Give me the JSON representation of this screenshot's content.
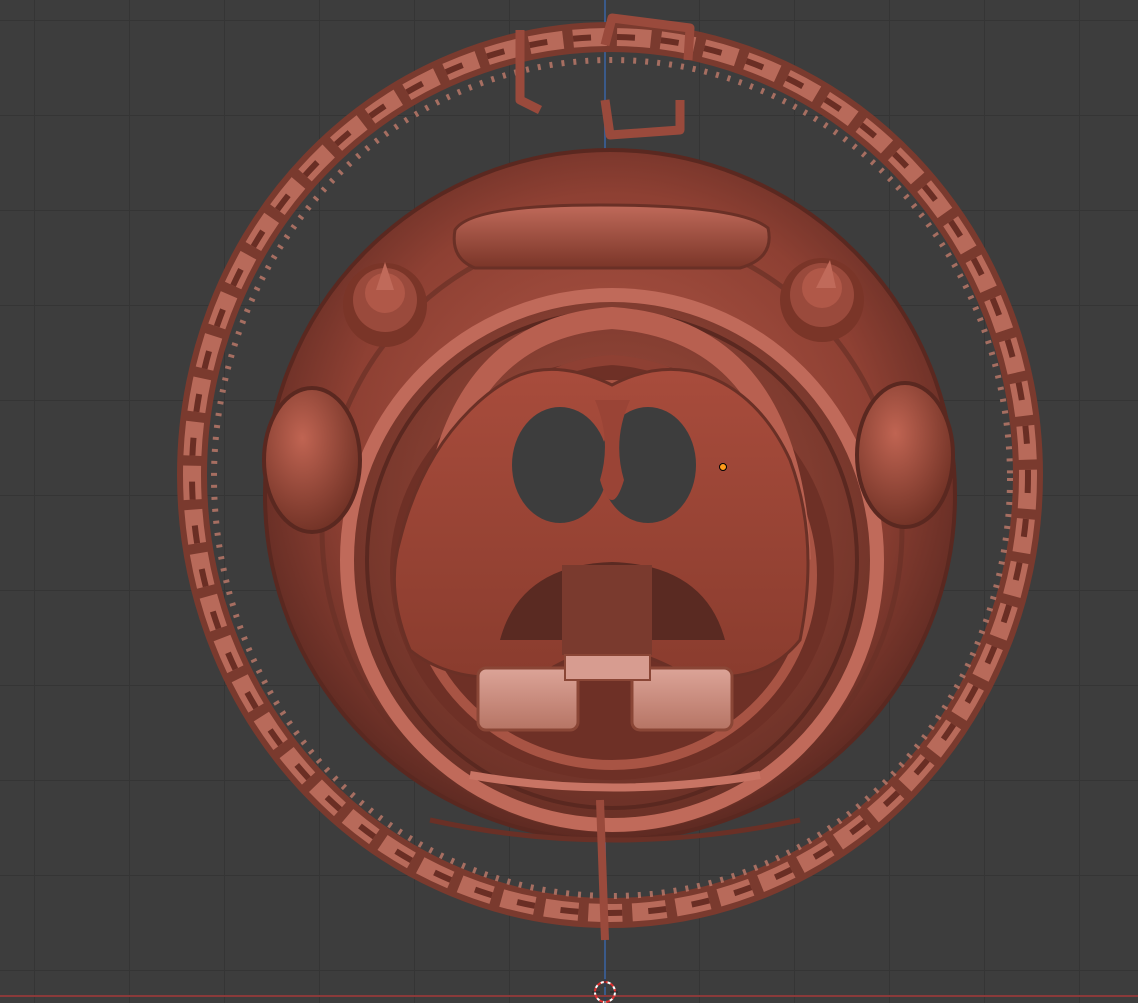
{
  "app": {
    "mode": "3d-viewport",
    "view": "front-orthographic"
  },
  "viewport": {
    "background_color": "#3d3d3d",
    "grid_color": "#353535",
    "x_axis_color": "#8a3a3a",
    "y_axis_color": "#3a5a8a"
  },
  "model": {
    "shading": "solid-clay",
    "base_color": "#9a4a3c",
    "highlight_color": "#c8776a",
    "shadow_color": "#5a2820"
  },
  "icons": {
    "cursor": "3d-cursor-icon",
    "origin": "object-origin-icon"
  }
}
